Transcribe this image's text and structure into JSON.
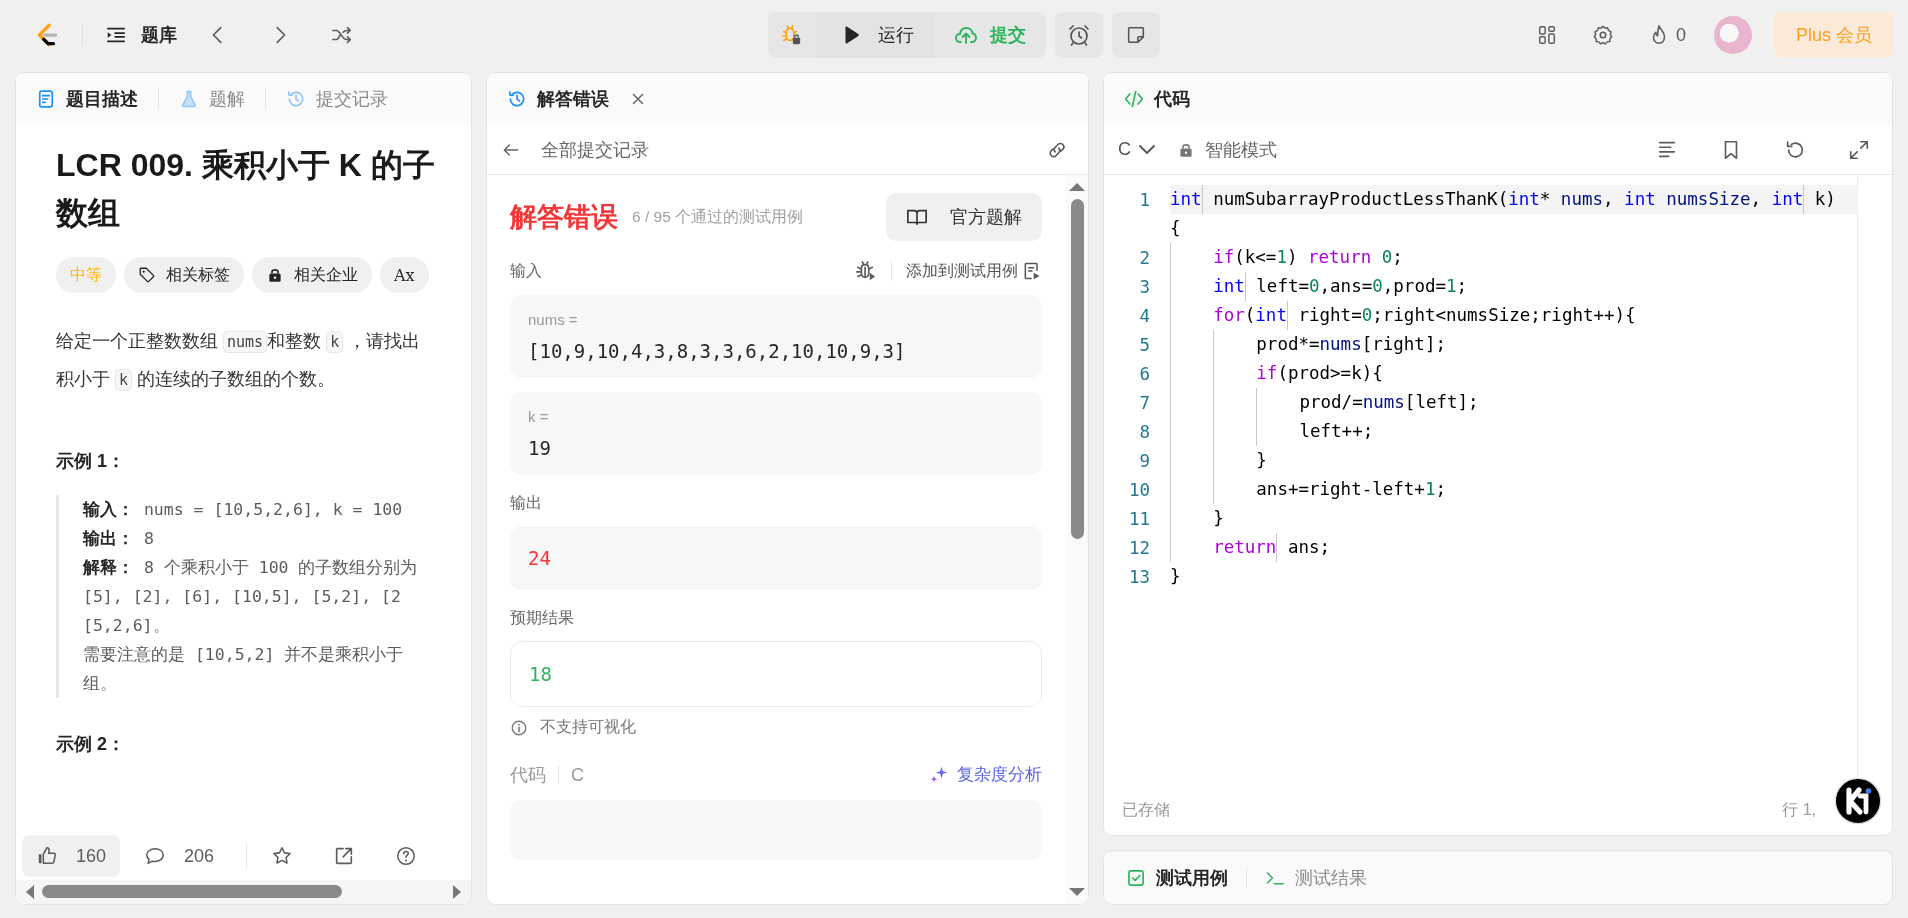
{
  "top_bar": {
    "problem_list": "题库",
    "run": "运行",
    "submit": "提交",
    "streak": "0",
    "plus": "Plus 会员"
  },
  "description_panel": {
    "tabs": [
      {
        "label": "题目描述",
        "selected": true
      },
      {
        "label": "题解",
        "selected": false
      },
      {
        "label": "提交记录",
        "selected": false
      }
    ],
    "title": "LCR 009. 乘积小于 K 的子数组",
    "tags": [
      {
        "kind": "difficulty",
        "label": "中等"
      },
      {
        "kind": "topics",
        "label": "相关标签"
      },
      {
        "kind": "companies",
        "label": "相关企业"
      },
      {
        "kind": "font",
        "label": "Ax"
      }
    ],
    "paragraph_lines": [
      [
        {
          "text": "给定一个正整数数组 "
        },
        {
          "text": "nums",
          "kind": "code"
        },
        {
          "text": "和整数 "
        },
        {
          "text": "k",
          "kind": "code"
        },
        {
          "text": " ，请找出"
        }
      ],
      [
        {
          "text": "积小于 "
        },
        {
          "text": "k",
          "kind": "code"
        },
        {
          "text": " 的连续的子数组的个数。"
        }
      ]
    ],
    "example_1": {
      "heading": "示例 1：",
      "lines": [
        "**输入：** nums = [10,5,2,6], k = 100",
        "**输出：** 8",
        "**解释：** 8 个乘积小于 100 的子数组分别为",
        "[5], [2], [6], [10,5], [5,2], [2",
        "[5,2,6]。",
        "需要注意的是 [10,5,2] 并不是乘积小于",
        "组。"
      ]
    },
    "example_2": {
      "heading": "示例 2："
    },
    "likes": "160",
    "comments": "206"
  },
  "result_panel": {
    "tab": "解答错误",
    "back_link": "全部提交记录",
    "status": {
      "text": "解答错误",
      "accepted": false
    },
    "passed": "6 / 95 个通过的测试用例",
    "solution_button": "官方题解",
    "input_label": "输入",
    "add_case": "添加到测试用例",
    "inputs": [
      {
        "name": "nums =",
        "value": "[10,9,10,4,3,8,3,3,6,2,10,10,9,3]"
      },
      {
        "name": "k =",
        "value": "19"
      }
    ],
    "output": {
      "label": "输出",
      "value": "24",
      "matches_expected": false
    },
    "expected": {
      "label": "预期结果",
      "value": "18",
      "matches_expected": true
    },
    "visual_note": "不支持可视化",
    "code_label": "代码",
    "code_language": "C",
    "complexity": "复杂度分析"
  },
  "code_panel": {
    "title": "代码",
    "language": "C",
    "mode": "智能模式",
    "lines": [
      {
        "number": "1",
        "tokens": [
          {
            "t": "int",
            "kind": "type"
          },
          {
            "t": " numSubarrayProductLessThanK("
          },
          {
            "t": "int",
            "kind": "type"
          },
          {
            "t": "* "
          },
          {
            "t": "nums",
            "kind": "var"
          },
          {
            "t": ", "
          },
          {
            "t": "int ",
            "kind": "type"
          },
          {
            "t": "numsSize",
            "kind": "var"
          },
          {
            "t": ", "
          },
          {
            "t": "int",
            "kind": "type"
          },
          {
            "t": " k)"
          }
        ]
      },
      {
        "tokens": [
          {
            "t": "{"
          }
        ]
      },
      {
        "number": "2",
        "tokens": [
          {
            "t": "    if",
            "kind": "keyword"
          },
          {
            "t": "(k<="
          },
          {
            "t": "1",
            "kind": "number"
          },
          {
            "t": ") "
          },
          {
            "t": "return ",
            "kind": "keyword"
          },
          {
            "t": "0",
            "kind": "number"
          },
          {
            "t": ";"
          }
        ]
      },
      {
        "number": "3",
        "tokens": [
          {
            "t": "    int",
            "kind": "type"
          },
          {
            "t": " left="
          },
          {
            "t": "0",
            "kind": "number"
          },
          {
            "t": ",ans="
          },
          {
            "t": "0",
            "kind": "number"
          },
          {
            "t": ",prod="
          },
          {
            "t": "1",
            "kind": "number"
          },
          {
            "t": ";"
          }
        ]
      },
      {
        "number": "4",
        "tokens": [
          {
            "t": "    for",
            "kind": "keyword"
          },
          {
            "t": "("
          },
          {
            "t": "int",
            "kind": "type"
          },
          {
            "t": " right="
          },
          {
            "t": "0",
            "kind": "number"
          },
          {
            "t": ";right<numsSize;right++){"
          }
        ]
      },
      {
        "number": "5",
        "tokens": [
          {
            "t": "        prod*="
          },
          {
            "t": "nums",
            "kind": "var"
          },
          {
            "t": "[right];"
          }
        ]
      },
      {
        "number": "6",
        "tokens": [
          {
            "t": "        if",
            "kind": "keyword"
          },
          {
            "t": "(prod>=k){"
          }
        ]
      },
      {
        "number": "7",
        "tokens": [
          {
            "t": "            prod/="
          },
          {
            "t": "nums",
            "kind": "var"
          },
          {
            "t": "[left];"
          }
        ]
      },
      {
        "number": "8",
        "tokens": [
          {
            "t": "            left++;"
          }
        ]
      },
      {
        "number": "9",
        "tokens": [
          {
            "t": "        }"
          }
        ]
      },
      {
        "number": "10",
        "tokens": [
          {
            "t": "        ans+=right-left+"
          },
          {
            "t": "1",
            "kind": "number"
          },
          {
            "t": ";"
          }
        ]
      },
      {
        "number": "11",
        "tokens": [
          {
            "t": "    }"
          }
        ]
      },
      {
        "number": "12",
        "tokens": [
          {
            "t": "    return",
            "kind": "keyword"
          },
          {
            "t": " ans;"
          }
        ]
      },
      {
        "number": "13",
        "tokens": [
          {
            "t": "}"
          }
        ]
      }
    ],
    "saved": "已存储",
    "cursor": "行 1,"
  },
  "test_panel": {
    "tabs": [
      {
        "label": "测试用例",
        "selected": true
      },
      {
        "label": "测试结果",
        "selected": false
      }
    ]
  }
}
